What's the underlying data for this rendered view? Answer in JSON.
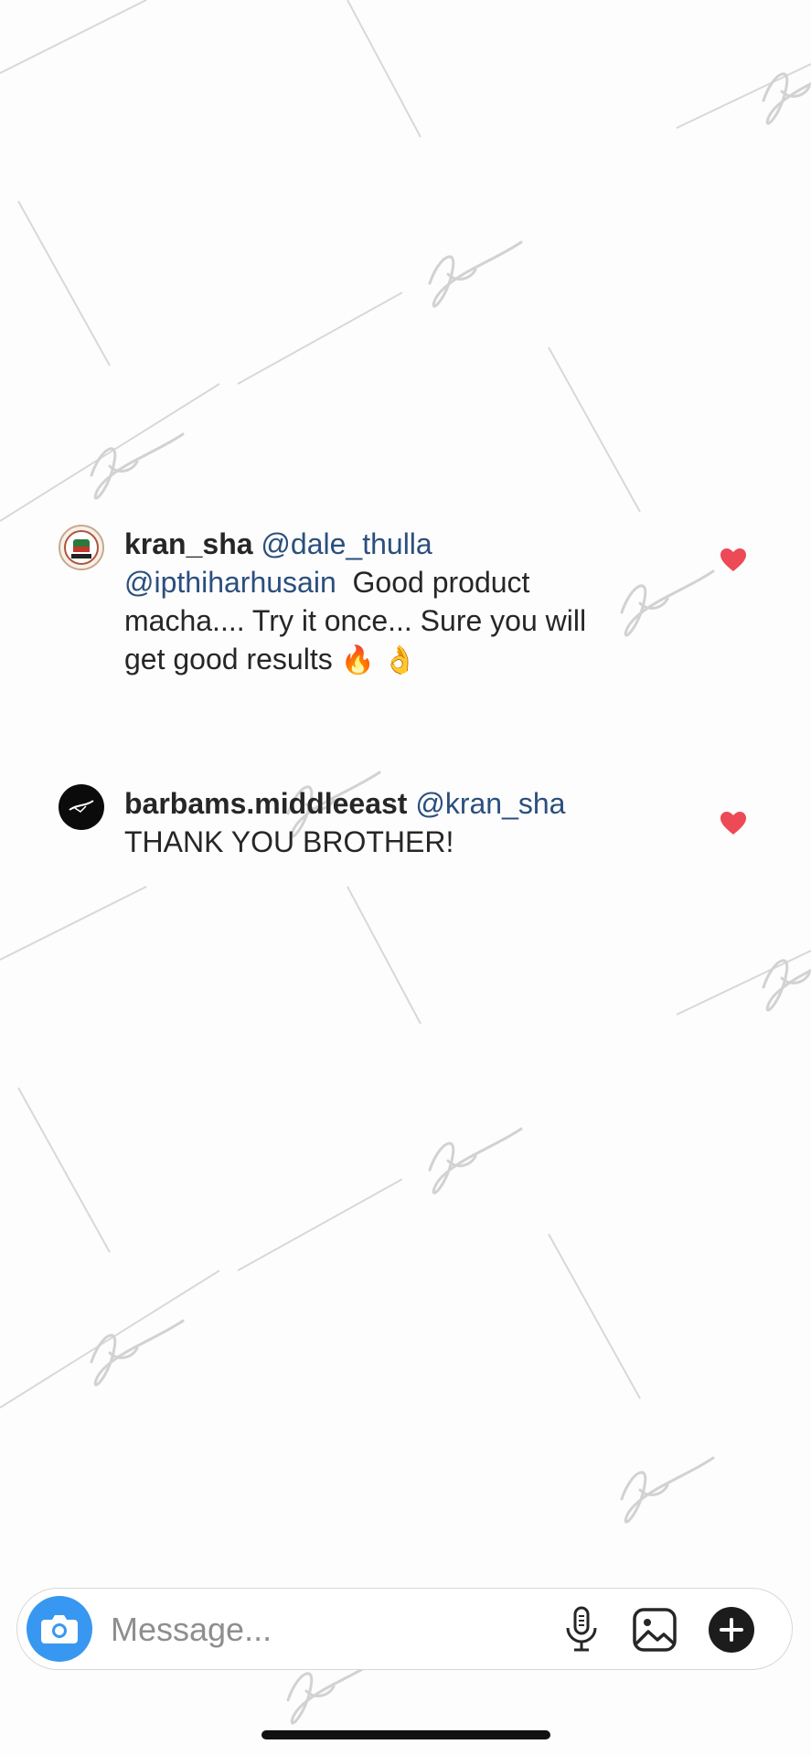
{
  "comments": [
    {
      "username": "kran_sha",
      "mention1": "@dale_thulla",
      "mention2": "@ipthiharhusain",
      "text_line1": "Good product",
      "text_line2": "macha.... Try it once... Sure you will",
      "text_line3": "get good results",
      "emoji1": "🔥",
      "emoji2": "👌",
      "liked": true
    },
    {
      "username": "barbams.middleeast",
      "mention1": "@kran_sha",
      "text_line1": "THANK YOU BROTHER!",
      "liked": true
    }
  ],
  "composer": {
    "placeholder": "Message...",
    "icons": [
      "camera-icon",
      "microphone-icon",
      "image-icon",
      "plus-icon"
    ]
  },
  "colors": {
    "mention": "#2b4f7e",
    "heart": "#ed4956",
    "camera": "#3897f0",
    "watermark": "#cfcfcf"
  }
}
